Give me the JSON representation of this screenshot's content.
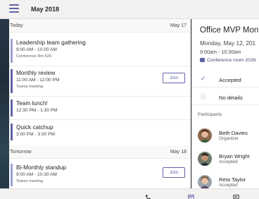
{
  "header": {
    "month": "May 2018",
    "menu_icon": "hamburger-menu-icon"
  },
  "days": [
    {
      "label": "Today",
      "date": "May 17"
    },
    {
      "label": "Tomorrow",
      "date": "May 18"
    }
  ],
  "events": [
    {
      "title": "Leadership team gathering",
      "time": "9:00 AM - 10:00 AM",
      "location": "Conference Rm 526",
      "join": ""
    },
    {
      "title": "Monthly review",
      "time": "11:00 AM - 12:00 PM",
      "location": "Teams meeting",
      "join": "Join"
    },
    {
      "title": "Team lunch!",
      "time": "12:30 PM - 1:30 PM",
      "location": "",
      "join": ""
    },
    {
      "title": "Quick catchup",
      "time": "3:00 PM - 3:30 PM",
      "location": "",
      "join": ""
    },
    {
      "title": "Bi-Monthly standup",
      "time": "9:00 AM - 10:30 AM",
      "location": "Teams meeting",
      "join": "Join"
    }
  ],
  "detail": {
    "subject": "Office MVP Mon",
    "date": "Monday, May 12, 201",
    "time": "9:00am - 10:30am",
    "room": "Conference room 2026",
    "status": [
      {
        "icon": "checkmark-icon",
        "text": "Accepted"
      },
      {
        "icon": "info-icon",
        "text": "No details"
      }
    ],
    "participants_label": "Participants",
    "participants": [
      {
        "name": "Beth Davies",
        "role": "Organizer"
      },
      {
        "name": "Bryan Wright",
        "role": "Accepted"
      },
      {
        "name": "Reta Taylor",
        "role": "Accepted"
      }
    ]
  },
  "colors": {
    "accent": "#6264a7",
    "event_bar": "#9ea1d4"
  },
  "bottom_icons": [
    "phone-icon",
    "calendar-icon",
    "chat-icon"
  ]
}
